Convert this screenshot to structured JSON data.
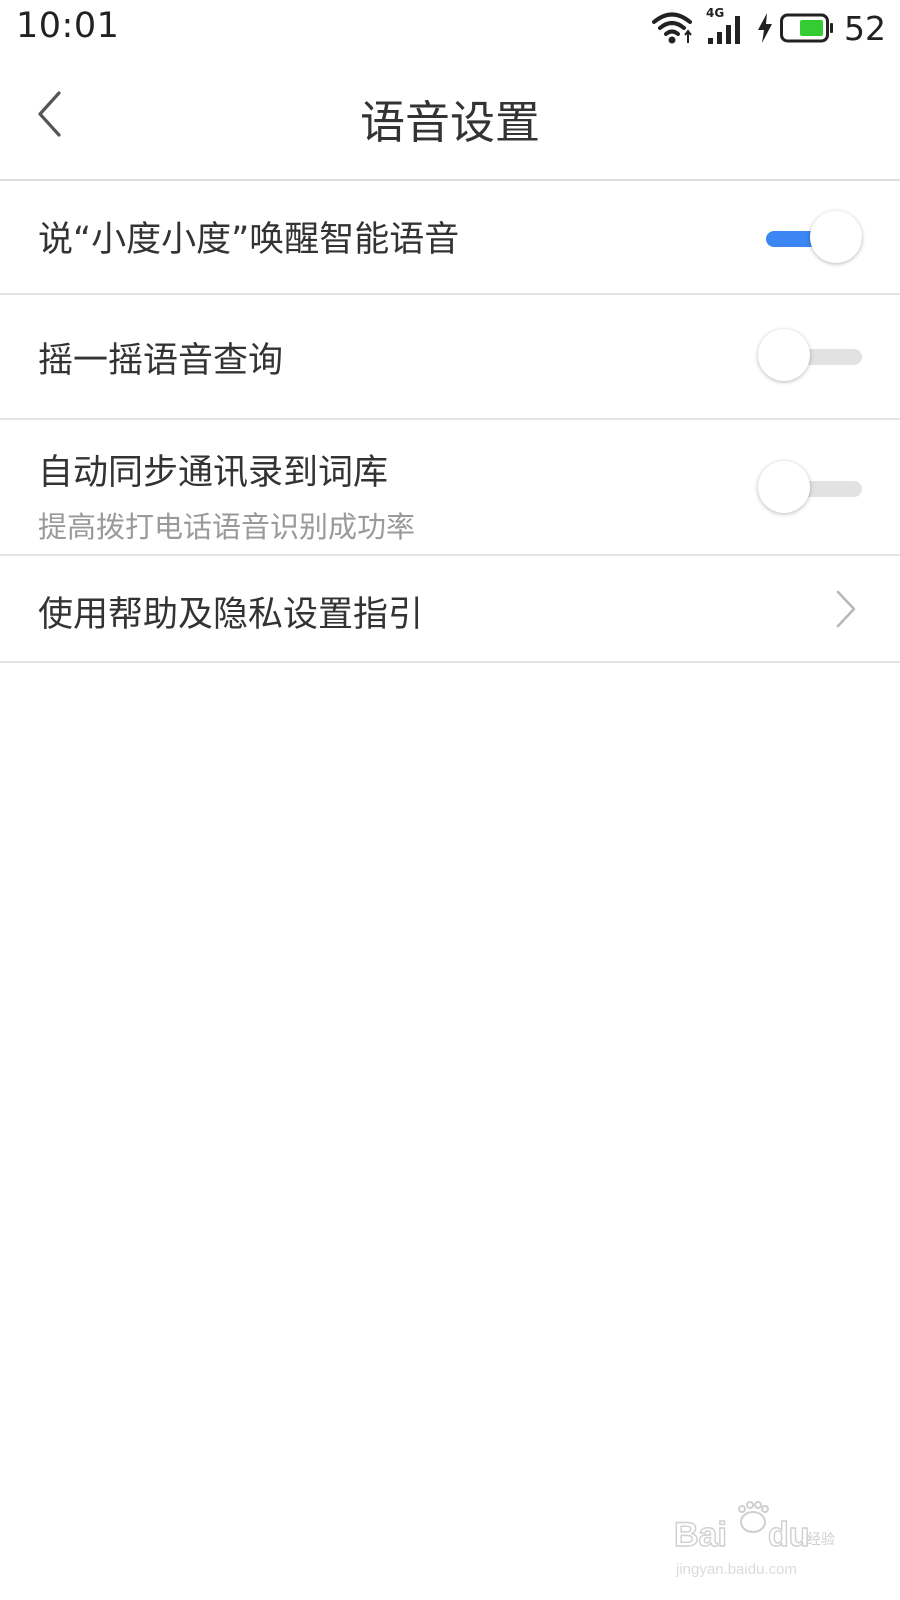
{
  "status_bar": {
    "time": "10:01",
    "network_type": "4G",
    "battery_level": "52",
    "battery_color": "#33cc33",
    "icons": [
      "wifi-icon",
      "cellular-signal-icon",
      "charging-bolt-icon",
      "battery-icon"
    ]
  },
  "header": {
    "back_icon": "chevron-left-icon",
    "title": "语音设置"
  },
  "settings": {
    "items": [
      {
        "label": "说“小度小度”唤醒智能语音",
        "control": "toggle",
        "enabled": true
      },
      {
        "label": "摇一摇语音查询",
        "control": "toggle",
        "enabled": false
      },
      {
        "label": "自动同步通讯录到词库",
        "sublabel": "提高拨打电话语音识别成功率",
        "control": "toggle",
        "enabled": false
      },
      {
        "label": "使用帮助及隐私设置指引",
        "control": "chevron-right-icon"
      }
    ]
  },
  "colors": {
    "accent": "#3b86f2",
    "toggle_off_track": "#e2e2e2",
    "divider": "#e4e4e4",
    "text_primary": "#333333",
    "text_secondary": "#9a9a9a"
  },
  "watermark": {
    "logo": "Baidu经验",
    "url_text": "jingyan.baidu.com"
  }
}
